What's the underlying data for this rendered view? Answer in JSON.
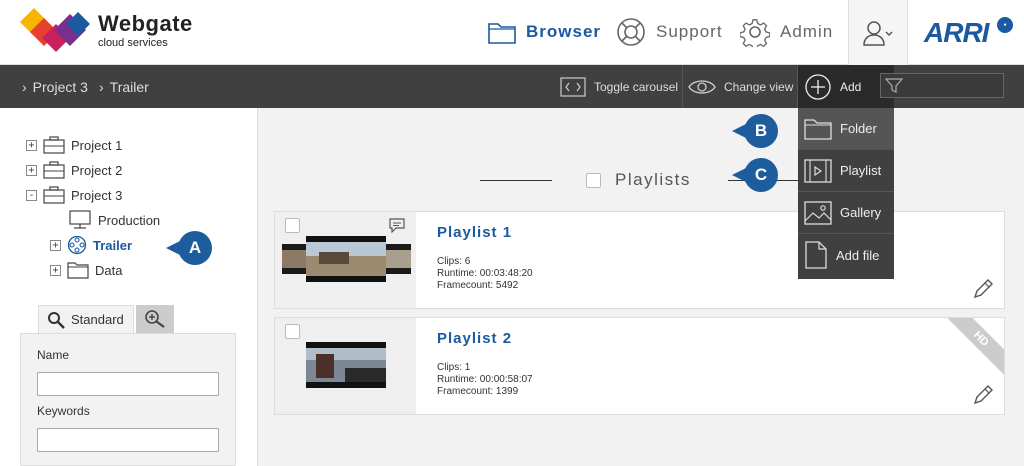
{
  "brand": {
    "name": "Webgate",
    "sub": "cloud services",
    "partner": "ARRI"
  },
  "nav": {
    "browser": "Browser",
    "support": "Support",
    "admin": "Admin"
  },
  "breadcrumb": [
    "Project 3",
    "Trailer"
  ],
  "toolbar": {
    "toggle_carousel": "Toggle carousel",
    "change_view": "Change view",
    "add": "Add"
  },
  "add_menu": [
    "Folder",
    "Playlist",
    "Gallery",
    "Add file"
  ],
  "tree": [
    {
      "label": "Project 1",
      "expander": "+"
    },
    {
      "label": "Project 2",
      "expander": "+"
    },
    {
      "label": "Project 3",
      "expander": "-"
    },
    {
      "label": "Production",
      "expander": ""
    },
    {
      "label": "Trailer",
      "expander": "+"
    },
    {
      "label": "Data",
      "expander": "+"
    }
  ],
  "markers": {
    "a": "A",
    "b": "B",
    "c": "C"
  },
  "search": {
    "tab_standard": "Standard",
    "name_label": "Name",
    "keywords_label": "Keywords",
    "name_value": "",
    "keywords_value": ""
  },
  "section": {
    "title": "Playlists"
  },
  "playlists": [
    {
      "title": "Playlist 1",
      "clips": "Clips: 6",
      "runtime": "Runtime: 00:03:48:20",
      "framecount": "Framecount: 5492"
    },
    {
      "title": "Playlist 2",
      "clips": "Clips: 1",
      "runtime": "Runtime: 00:00:58:07",
      "framecount": "Framecount: 1399",
      "badge": "HD"
    }
  ],
  "colors": {
    "accent": "#1b5aa0",
    "toolbar": "#404040",
    "marker": "#1d5d9e"
  }
}
